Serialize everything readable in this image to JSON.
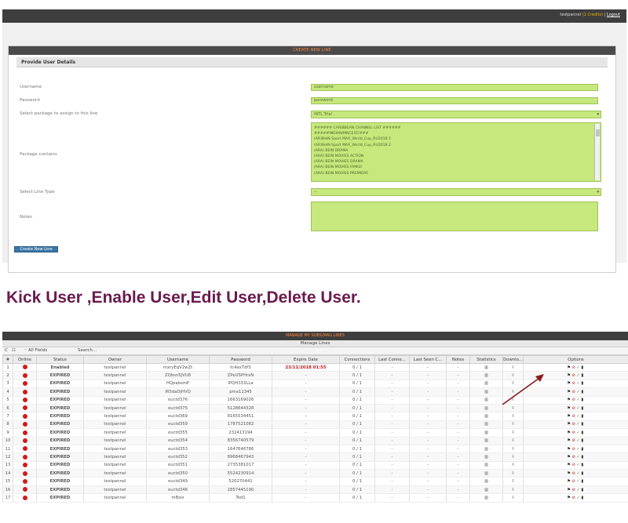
{
  "topbar": {
    "user": "testpannel",
    "credits": "(1 Credits)",
    "separator": "|",
    "logout": "Logout"
  },
  "form": {
    "header": "CREATE NEW LINE",
    "section_title": "Provide User Details",
    "username_label": "Username",
    "username_value": "username",
    "password_label": "Password",
    "password_value": "password",
    "package_label": "Select package to assign to this line",
    "package_value": "INTL Trial",
    "package_contains_label": "Package contains",
    "package_items": [
      "###### CARIBBEAN CHANNEL LIST ######",
      "#####INDIAN/MNCEST/###",
      "(AR)BeIN Sport MAX_World_Cup_RU2018 1",
      "(AR)BeIN Sport MAX_World_Cup_RU2018 2",
      "(ARA) BEIN DRAMA",
      "(ARA) BEIN MOVIES ACTION",
      "(ARA) BEIN MOVIES DRAMA",
      "(ARA) BEIN MOVIES FAMILY",
      "(ARA) BEIN MOVIES PREMIERE"
    ],
    "line_type_label": "Select Line Type",
    "line_type_value": "--",
    "notes_label": "Notes",
    "create_button": "Create New Line"
  },
  "caption": "Kick User ,Enable User,Edit User,Delete User.",
  "grid": {
    "header": "MANAGE MY SUBS/MAG LINES",
    "subheader": "Manage Lines",
    "tools": {
      "refresh": "C",
      "columns": "☷",
      "search_field": "◦ All Fields",
      "search_label": "Search..."
    },
    "columns": [
      "#",
      "Online",
      "Status",
      "Owner",
      "Username",
      "Password",
      "Expire Date",
      "Connections",
      "Last Conne...",
      "Last Seen C...",
      "Notes",
      "Statistics",
      "Downlo...",
      "Options"
    ],
    "rows": [
      {
        "n": "1",
        "status": "Enabled",
        "owner": "testpannel",
        "username": "mxryEqV2wZt",
        "password": "tc4axTdf3",
        "expire": "23/11/2018 01:55",
        "conn": "0 / 1",
        "lastconn": "-",
        "lastseen": "-",
        "notes": "-"
      },
      {
        "n": "2",
        "status": "EXPIRED",
        "owner": "testpannel",
        "username": "ZQbsn5JVU8",
        "password": "ZPeUSPHrxN",
        "expire": "-",
        "conn": "0 / 1",
        "lastconn": "-",
        "lastseen": "-",
        "notes": "-"
      },
      {
        "n": "3",
        "status": "EXPIRED",
        "owner": "testpannel",
        "username": "HQpabsmP",
        "password": "IPQH333LLa",
        "expire": "-",
        "conn": "0 / 1",
        "lastconn": "-",
        "lastseen": "-",
        "notes": "-"
      },
      {
        "n": "4",
        "status": "EXPIRED",
        "owner": "testpannel",
        "username": "IR5daDjHVQ",
        "password": "pma11345",
        "expire": "-",
        "conn": "0 / 1",
        "lastconn": "-",
        "lastseen": "-",
        "notes": "-"
      },
      {
        "n": "5",
        "status": "EXPIRED",
        "owner": "testpannel",
        "username": "euctd376",
        "password": "1663169026",
        "expire": "-",
        "conn": "0 / 1",
        "lastconn": "-",
        "lastseen": "-",
        "notes": "-"
      },
      {
        "n": "6",
        "status": "EXPIRED",
        "owner": "testpannel",
        "username": "euctd375",
        "password": "5128644328",
        "expire": "-",
        "conn": "0 / 1",
        "lastconn": "-",
        "lastseen": "-",
        "notes": "-"
      },
      {
        "n": "7",
        "status": "EXPIRED",
        "owner": "testpannel",
        "username": "euctd369",
        "password": "8165534451",
        "expire": "-",
        "conn": "0 / 1",
        "lastconn": "-",
        "lastseen": "-",
        "notes": "-"
      },
      {
        "n": "8",
        "status": "EXPIRED",
        "owner": "testpannel",
        "username": "euctd359",
        "password": "1787521082",
        "expire": "-",
        "conn": "0 / 1",
        "lastconn": "-",
        "lastseen": "-",
        "notes": "-"
      },
      {
        "n": "9",
        "status": "EXPIRED",
        "owner": "testpannel",
        "username": "euctd355",
        "password": "232413194",
        "expire": "-",
        "conn": "0 / 1",
        "lastconn": "-",
        "lastseen": "-",
        "notes": "-"
      },
      {
        "n": "10",
        "status": "EXPIRED",
        "owner": "testpannel",
        "username": "euctd354",
        "password": "8356740579",
        "expire": "-",
        "conn": "0 / 1",
        "lastconn": "-",
        "lastseen": "-",
        "notes": "-"
      },
      {
        "n": "11",
        "status": "EXPIRED",
        "owner": "testpannel",
        "username": "euctd353",
        "password": "1647646786",
        "expire": "-",
        "conn": "0 / 1",
        "lastconn": "-",
        "lastseen": "-",
        "notes": "-"
      },
      {
        "n": "12",
        "status": "EXPIRED",
        "owner": "testpannel",
        "username": "euctd352",
        "password": "8968467943",
        "expire": "-",
        "conn": "0 / 1",
        "lastconn": "-",
        "lastseen": "-",
        "notes": "-"
      },
      {
        "n": "13",
        "status": "EXPIRED",
        "owner": "testpannel",
        "username": "euctd351",
        "password": "2735381017",
        "expire": "-",
        "conn": "0 / 1",
        "lastconn": "-",
        "lastseen": "-",
        "notes": "-"
      },
      {
        "n": "14",
        "status": "EXPIRED",
        "owner": "testpannel",
        "username": "euctd350",
        "password": "5524230914",
        "expire": "-",
        "conn": "0 / 1",
        "lastconn": "-",
        "lastseen": "-",
        "notes": "-"
      },
      {
        "n": "15",
        "status": "EXPIRED",
        "owner": "testpannel",
        "username": "euctd349",
        "password": "520270441",
        "expire": "-",
        "conn": "0 / 1",
        "lastconn": "-",
        "lastseen": "-",
        "notes": "-"
      },
      {
        "n": "16",
        "status": "EXPIRED",
        "owner": "testpannel",
        "username": "euctd348",
        "password": "2857445190",
        "expire": "-",
        "conn": "0 / 1",
        "lastconn": "-",
        "lastseen": "-",
        "notes": "-"
      },
      {
        "n": "17",
        "status": "EXPIRED",
        "owner": "testpannel",
        "username": "mBsix",
        "password": "Ted1",
        "expire": "-",
        "conn": "0 / 1",
        "lastconn": "-",
        "lastseen": "-",
        "notes": "-"
      }
    ],
    "icons": {
      "statistics": "bar-chart-icon",
      "download": "download-icon",
      "kick": "kick-user-icon",
      "toggle": "disable-user-icon",
      "edit": "edit-user-icon",
      "delete": "delete-user-icon"
    },
    "glyphs": {
      "statistics": "▥",
      "download": "⇩",
      "kick": "⚑",
      "toggle": "⊘",
      "edit": "✓",
      "delete": "▮"
    }
  },
  "colors": {
    "input_bg": "#c6e87c",
    "header_bar": "#3e3e3e",
    "header_text": "#ff8a3c",
    "caption": "#6a1b4d",
    "enabled": "#2e8b2e",
    "expired": "#1a1aa8",
    "online_dot": "#d11a1a",
    "arrow": "#8b1a1a"
  }
}
